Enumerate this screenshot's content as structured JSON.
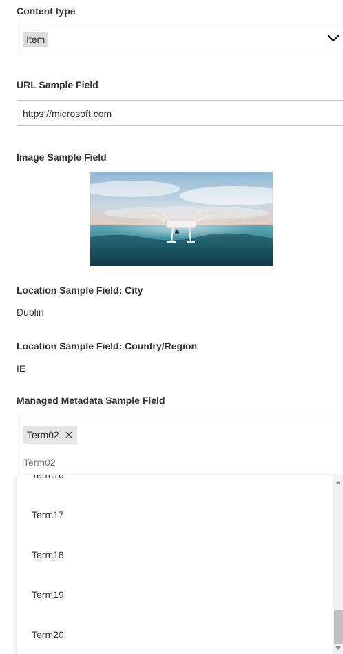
{
  "content_type": {
    "label": "Content type",
    "selected": "Item"
  },
  "url_field": {
    "label": "URL Sample Field",
    "value": "https://microsoft.com"
  },
  "image_field": {
    "label": "Image Sample Field"
  },
  "location_city": {
    "label": "Location Sample Field: City",
    "value": "Dublin"
  },
  "location_country": {
    "label": "Location Sample Field: Country/Region",
    "value": "IE"
  },
  "managed_metadata": {
    "label": "Managed Metadata Sample Field",
    "tag": "Term02",
    "input_text": "Term02",
    "suggestions": [
      "Term17",
      "Term18",
      "Term19",
      "Term20"
    ]
  },
  "colors": {
    "border": "#c8c8c8",
    "text": "#333333",
    "tag_bg": "#e6e6e6",
    "scroll_thumb": "#c1c1c1"
  }
}
